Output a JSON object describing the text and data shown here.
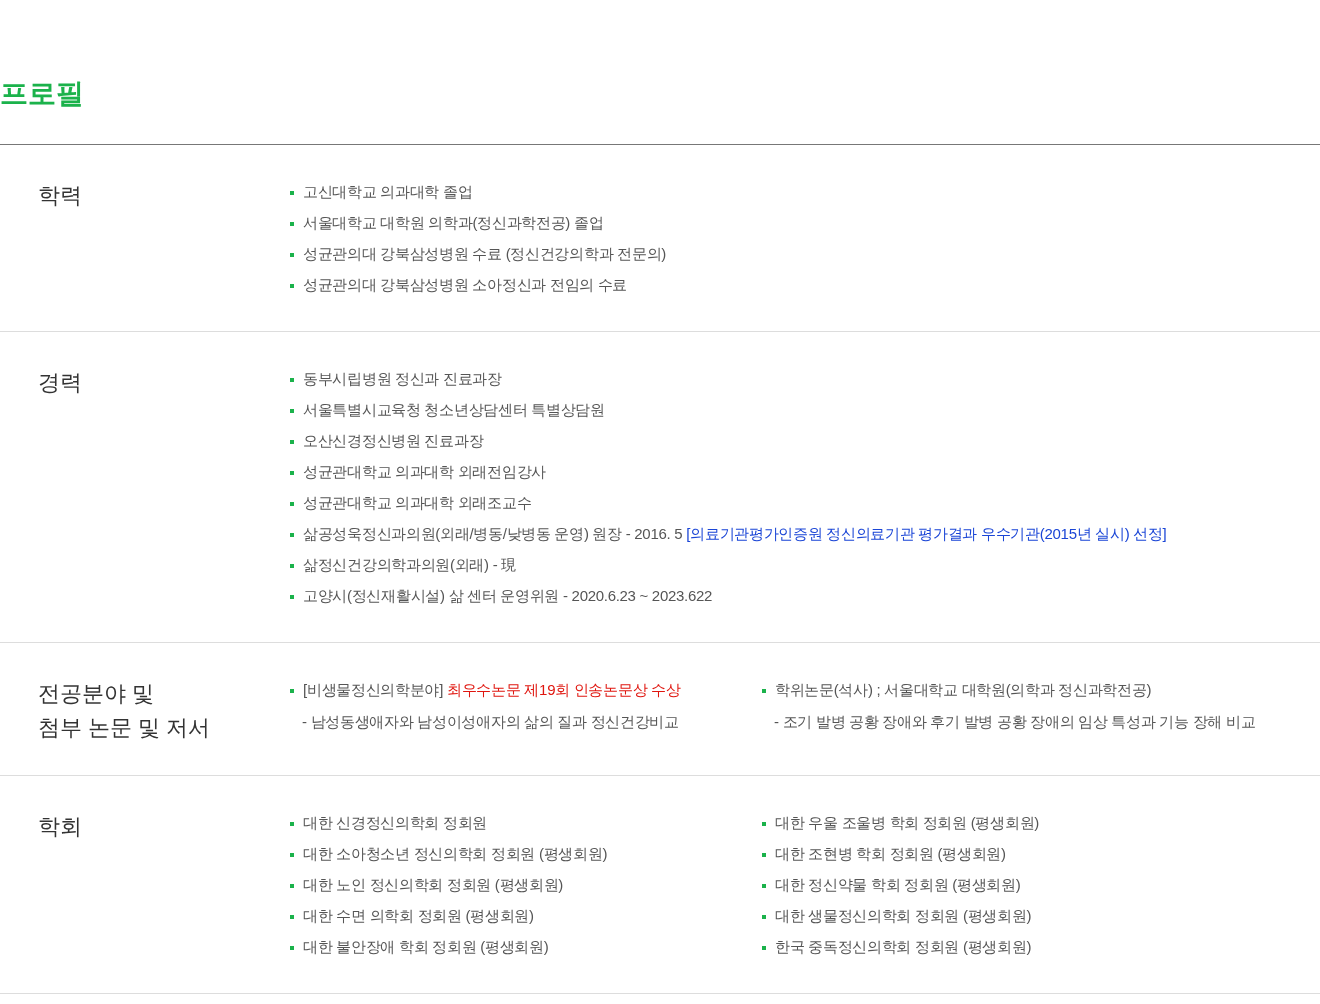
{
  "page_title": "프로필",
  "sections": [
    {
      "title_lines": [
        "학력"
      ],
      "columns": [
        [
          {
            "segments": [
              {
                "text": "고신대학교 의과대학 졸업",
                "kind": "plain"
              }
            ]
          },
          {
            "segments": [
              {
                "text": "서울대학교 대학원 의학과(정신과학전공) 졸업",
                "kind": "plain"
              }
            ]
          },
          {
            "segments": [
              {
                "text": "성균관의대 강북삼성병원 수료 (정신건강의학과 전문의)",
                "kind": "plain"
              }
            ]
          },
          {
            "segments": [
              {
                "text": "성균관의대 강북삼성병원 소아정신과 전임의 수료",
                "kind": "plain"
              }
            ]
          }
        ]
      ]
    },
    {
      "title_lines": [
        "경력"
      ],
      "columns": [
        [
          {
            "segments": [
              {
                "text": "동부시립병원 정신과 진료과장",
                "kind": "plain"
              }
            ]
          },
          {
            "segments": [
              {
                "text": "서울특별시교육청 청소년상담센터 특별상담원",
                "kind": "plain"
              }
            ]
          },
          {
            "segments": [
              {
                "text": "오산신경정신병원 진료과장",
                "kind": "plain"
              }
            ]
          },
          {
            "segments": [
              {
                "text": "성균관대학교 의과대학 외래전임강사",
                "kind": "plain"
              }
            ]
          },
          {
            "segments": [
              {
                "text": "성균관대학교 의과대학 외래조교수",
                "kind": "plain"
              }
            ]
          },
          {
            "segments": [
              {
                "text": "삶공성욱정신과의원(외래/병동/낮병동 운영) 원장 - 2016. 5",
                "kind": "plain"
              },
              {
                "text": "[의료기관평가인증원 정신의료기관 평가결과 우수기관(2015년 실시) 선정]",
                "kind": "blue"
              }
            ]
          },
          {
            "segments": [
              {
                "text": "삶정신건강의학과의원(외래) - 現",
                "kind": "plain"
              }
            ]
          },
          {
            "segments": [
              {
                "text": "고양시(정신재활시설) 삶 센터 운영위원 - 2020.6.23 ~ 2023.622",
                "kind": "plain"
              }
            ]
          }
        ]
      ]
    },
    {
      "title_lines": [
        "전공분야 및",
        "첨부 논문 및 저서"
      ],
      "columns": [
        [
          {
            "segments": [
              {
                "text": "[비생물정신의학분야]",
                "kind": "plain"
              },
              {
                "text": "최우수논문 제19회 인송논문상 수상",
                "kind": "red"
              }
            ],
            "sub": "- 남성동생애자와 남성이성애자의 삶의 질과 정신건강비교"
          }
        ],
        [
          {
            "segments": [
              {
                "text": "학위논문(석사) ; 서울대학교 대학원(의학과 정신과학전공)",
                "kind": "plain"
              }
            ],
            "sub": "- 조기 발병 공황 장애와 후기 발병 공황 장애의 임상 특성과 기능 장해 비교"
          }
        ]
      ]
    },
    {
      "title_lines": [
        "학회"
      ],
      "columns": [
        [
          {
            "segments": [
              {
                "text": "대한 신경정신의학회 정회원",
                "kind": "plain"
              }
            ]
          },
          {
            "segments": [
              {
                "text": "대한 소아청소년 정신의학회 정회원 (평생회원)",
                "kind": "plain"
              }
            ]
          },
          {
            "segments": [
              {
                "text": "대한 노인 정신의학회 정회원 (평생회원)",
                "kind": "plain"
              }
            ]
          },
          {
            "segments": [
              {
                "text": "대한 수면 의학회 정회원 (평생회원)",
                "kind": "plain"
              }
            ]
          },
          {
            "segments": [
              {
                "text": "대한 불안장애 학회 정회원 (평생회원)",
                "kind": "plain"
              }
            ]
          }
        ],
        [
          {
            "segments": [
              {
                "text": "대한 우울 조울병 학회 정회원 (평생회원)",
                "kind": "plain"
              }
            ]
          },
          {
            "segments": [
              {
                "text": "대한 조현병 학회 정회원 (평생회원)",
                "kind": "plain"
              }
            ]
          },
          {
            "segments": [
              {
                "text": "대한 정신약물 학회 정회원 (평생회원)",
                "kind": "plain"
              }
            ]
          },
          {
            "segments": [
              {
                "text": "대한 생물정신의학회 정회원 (평생회원)",
                "kind": "plain"
              }
            ]
          },
          {
            "segments": [
              {
                "text": "한국 중독정신의학회 정회원 (평생회원)",
                "kind": "plain"
              }
            ]
          }
        ]
      ]
    }
  ]
}
